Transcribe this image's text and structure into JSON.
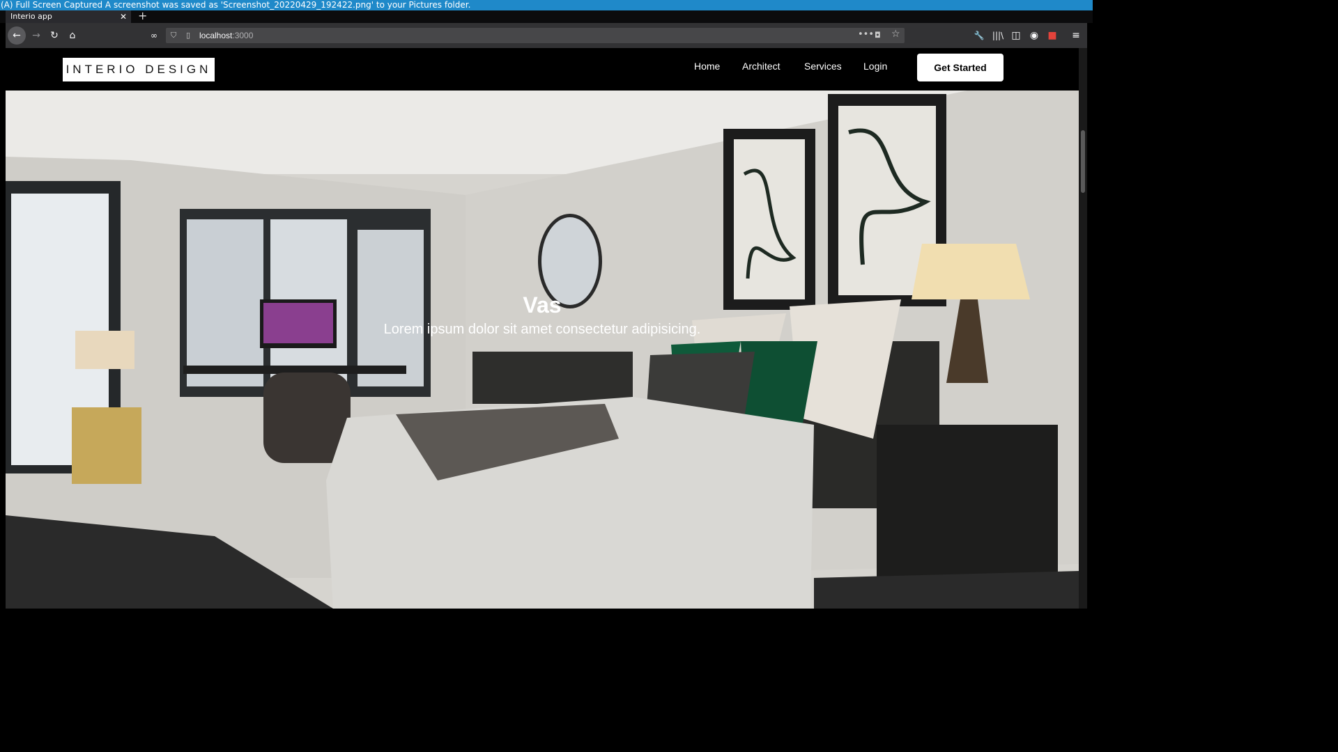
{
  "notification": "(A) Full Screen Captured A screenshot was saved as 'Screenshot_20220429_192422.png' to your Pictures folder.",
  "browser": {
    "tab_title": "Interio app",
    "tab_close": "✕",
    "new_tab": "+",
    "url_host": "localhost",
    "url_port": ":3000",
    "icons": [
      "back-icon",
      "forward-icon",
      "reload-icon",
      "home-icon",
      "tracking-icon",
      "shield-icon",
      "page-icon",
      "more-icon",
      "pocket-icon",
      "star-icon",
      "wrench-icon",
      "library-icon",
      "sidebar-icon",
      "account-icon",
      "extension-icon",
      "menu-icon"
    ]
  },
  "site": {
    "logo": "INTERIO DESIGN",
    "nav": [
      "Home",
      "Architect",
      "Services",
      "Login"
    ],
    "cta": "Get Started",
    "hero_title": "Vas",
    "hero_subtitle": "Lorem ipsum dolor sit amet consectetur adipisicing."
  },
  "colors": {
    "notification_bg": "#1f89c9",
    "toolbar_bg": "#323234",
    "navbar_bg": "#000000",
    "cta_bg": "#ffffff"
  }
}
